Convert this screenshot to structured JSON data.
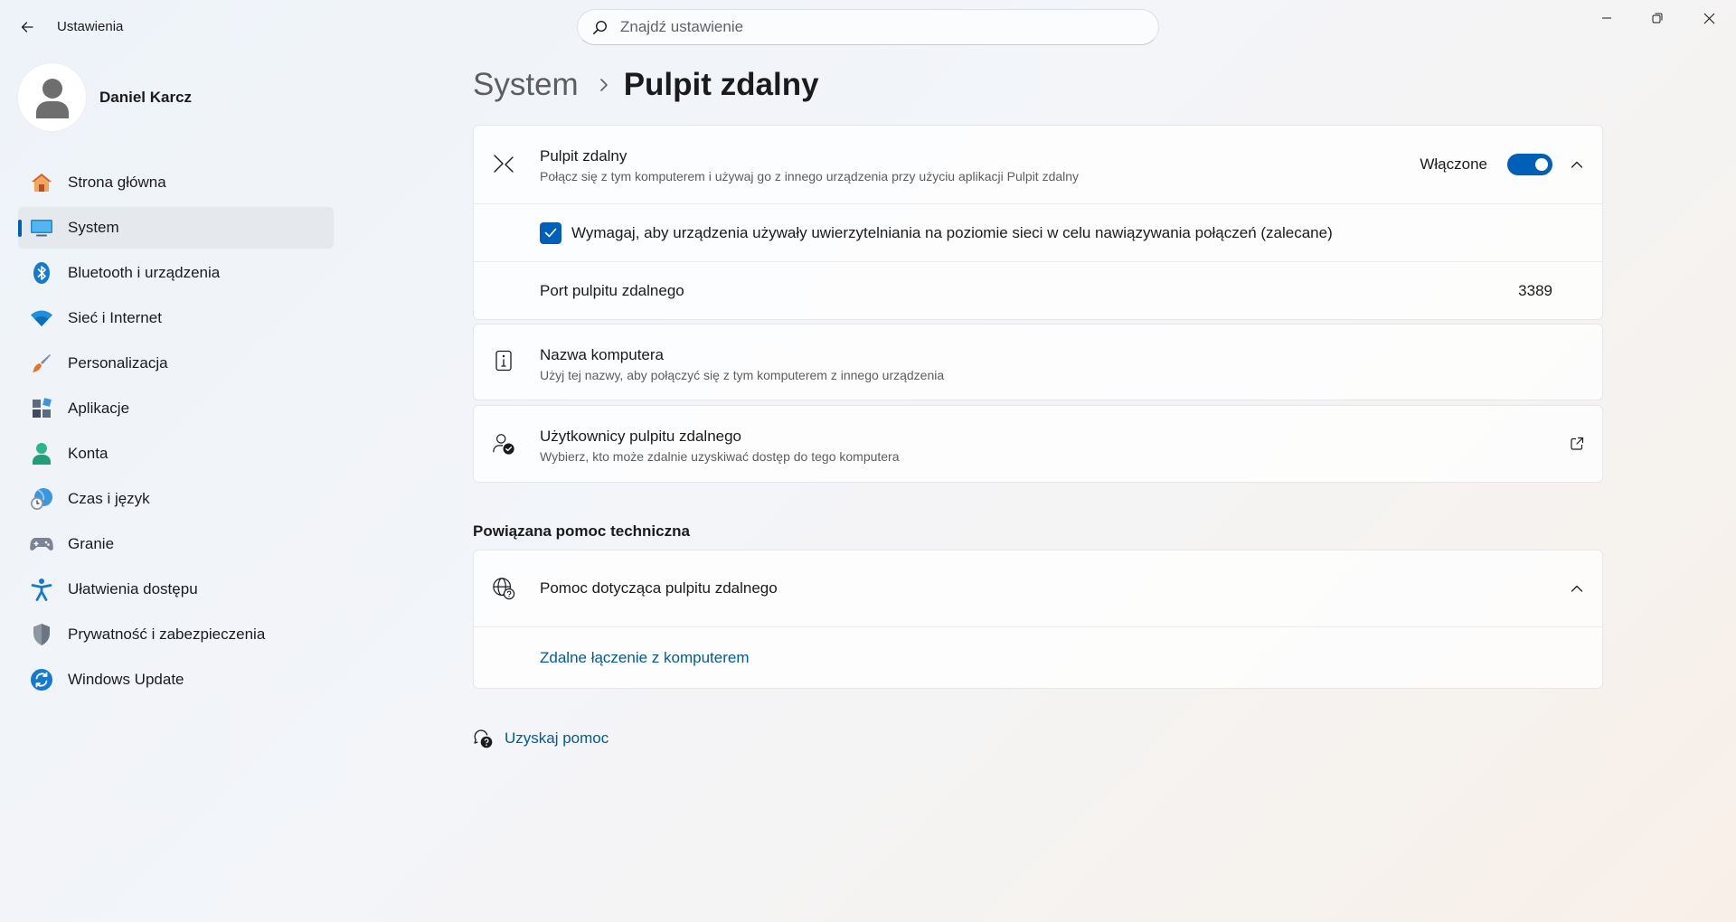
{
  "window": {
    "app_title": "Ustawienia"
  },
  "search": {
    "placeholder": "Znajdź ustawienie"
  },
  "profile": {
    "name": "Daniel Karcz"
  },
  "sidebar": {
    "items": [
      {
        "label": "Strona główna",
        "icon": "home-icon"
      },
      {
        "label": "System",
        "icon": "system-icon",
        "active": true
      },
      {
        "label": "Bluetooth i urządzenia",
        "icon": "bluetooth-icon"
      },
      {
        "label": "Sieć i Internet",
        "icon": "wifi-icon"
      },
      {
        "label": "Personalizacja",
        "icon": "brush-icon"
      },
      {
        "label": "Aplikacje",
        "icon": "apps-icon"
      },
      {
        "label": "Konta",
        "icon": "account-icon"
      },
      {
        "label": "Czas i język",
        "icon": "time-language-icon"
      },
      {
        "label": "Granie",
        "icon": "gamepad-icon"
      },
      {
        "label": "Ułatwienia dostępu",
        "icon": "accessibility-icon"
      },
      {
        "label": "Prywatność i zabezpieczenia",
        "icon": "shield-icon"
      },
      {
        "label": "Windows Update",
        "icon": "windows-update-icon"
      }
    ]
  },
  "breadcrumb": {
    "parent": "System",
    "current": "Pulpit zdalny"
  },
  "remote_desktop": {
    "title": "Pulpit zdalny",
    "description": "Połącz się z tym komputerem i używaj go z innego urządzenia przy użyciu aplikacji Pulpit zdalny",
    "toggle_label": "Włączone",
    "toggle_on": true,
    "nla_label": "Wymagaj, aby urządzenia używały uwierzytelniania na poziomie sieci w celu nawiązywania połączeń (zalecane)",
    "nla_checked": true,
    "port_label": "Port pulpitu zdalnego",
    "port_value": "3389"
  },
  "computer_name": {
    "title": "Nazwa komputera",
    "description": "Użyj tej nazwy, aby połączyć się z tym komputerem z innego urządzenia"
  },
  "remote_users": {
    "title": "Użytkownicy pulpitu zdalnego",
    "description": "Wybierz, kto może zdalnie uzyskiwać dostęp do tego komputera"
  },
  "related_help": {
    "section_title": "Powiązana pomoc techniczna",
    "title": "Pomoc dotycząca pulpitu zdalnego",
    "link": "Zdalne łączenie z komputerem"
  },
  "get_help": {
    "label": "Uzyskaj pomoc"
  },
  "colors": {
    "accent": "#005fb8",
    "link": "#005a9e"
  }
}
